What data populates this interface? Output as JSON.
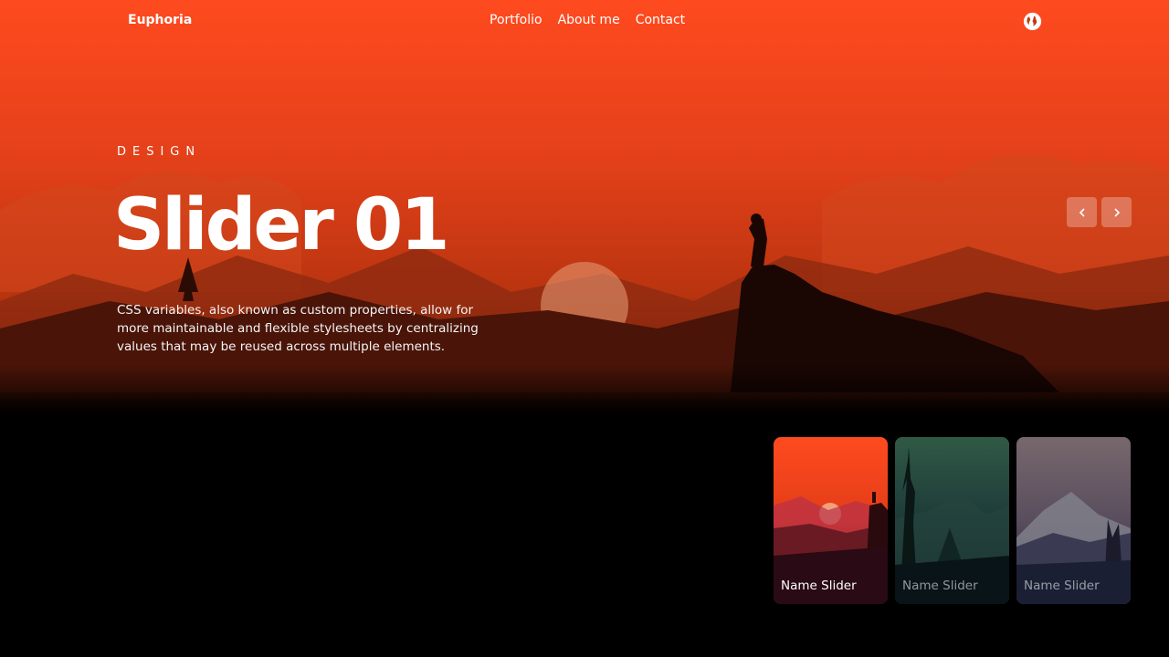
{
  "brand": "Euphoria",
  "nav": {
    "links": [
      "Portfolio",
      "About me",
      "Contact"
    ],
    "globe_icon": "globe-icon"
  },
  "slide": {
    "category": "DESIGN",
    "title": "Slider 01",
    "description": "CSS variables, also known as custom properties, allow for more maintainable and flexible stylesheets by centralizing values that may be reused across multiple elements."
  },
  "controls": {
    "prev_icon": "chevron-left-icon",
    "next_icon": "chevron-right-icon"
  },
  "thumbnails": [
    {
      "label": "Name Slider",
      "active": true
    },
    {
      "label": "Name Slider",
      "active": false
    },
    {
      "label": "Name Slider",
      "active": false
    }
  ],
  "colors": {
    "sky_top": "#ff4a1f",
    "sky_mid": "#c43a12",
    "accent_red": "#e8401a",
    "background": "#000000"
  }
}
